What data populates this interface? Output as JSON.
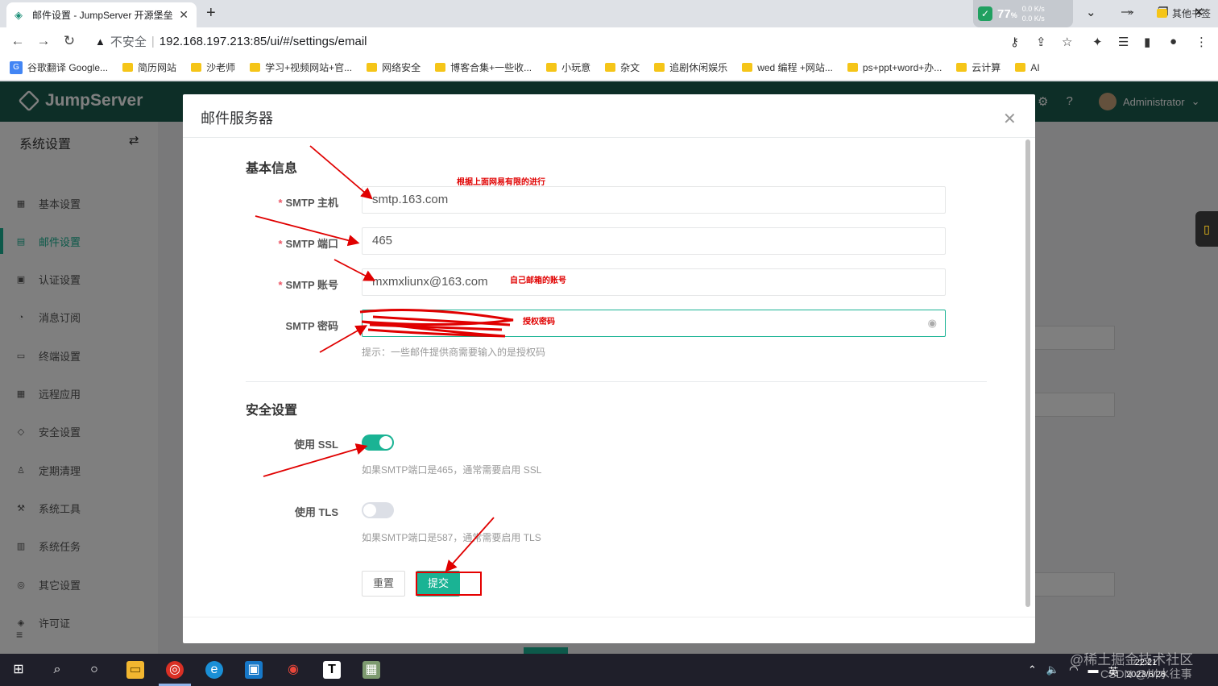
{
  "browser": {
    "tab_title": "邮件设置 - JumpServer 开源堡垒",
    "cpu_percent": "77",
    "speed_up": "0.0",
    "speed_down": "0.0",
    "speed_unit": "K/s",
    "address_insecure": "不安全",
    "address_url": "192.168.197.213:85/ui/#/settings/email",
    "bookmarks": [
      {
        "label": "谷歌翻译 Google...",
        "icon": "translate-icon"
      },
      {
        "label": "简历网站",
        "icon": "folder-icon"
      },
      {
        "label": "沙老师",
        "icon": "folder-icon"
      },
      {
        "label": "学习+视频网站+官...",
        "icon": "folder-icon"
      },
      {
        "label": "网络安全",
        "icon": "folder-icon"
      },
      {
        "label": "博客合集+一些收...",
        "icon": "folder-icon"
      },
      {
        "label": "小玩意",
        "icon": "folder-icon"
      },
      {
        "label": "杂文",
        "icon": "folder-icon"
      },
      {
        "label": "追剧休闲娱乐",
        "icon": "folder-icon"
      },
      {
        "label": "wed 编程 +网站...",
        "icon": "folder-icon"
      },
      {
        "label": "ps+ppt+word+办...",
        "icon": "folder-icon"
      },
      {
        "label": "云计算",
        "icon": "folder-icon"
      },
      {
        "label": "AI",
        "icon": "folder-icon"
      }
    ],
    "bookmarks_more": "»",
    "bookmarks_other": "其他书签"
  },
  "app": {
    "logo": "JumpServer",
    "user": "Administrator",
    "sidebar_title": "系统设置",
    "sidebar_items": [
      {
        "label": "基本设置",
        "active": false
      },
      {
        "label": "邮件设置",
        "active": true
      },
      {
        "label": "认证设置",
        "active": false
      },
      {
        "label": "消息订阅",
        "active": false
      },
      {
        "label": "终端设置",
        "active": false
      },
      {
        "label": "远程应用",
        "active": false
      },
      {
        "label": "安全设置",
        "active": false
      },
      {
        "label": "定期清理",
        "active": false
      },
      {
        "label": "系统工具",
        "active": false
      },
      {
        "label": "系统任务",
        "active": false
      },
      {
        "label": "其它设置",
        "active": false
      },
      {
        "label": "许可证",
        "active": false
      }
    ]
  },
  "dialog": {
    "title": "邮件服务器",
    "basic_section": "基本信息",
    "host_label": "SMTP 主机",
    "host_value": "smtp.163.com",
    "port_label": "SMTP 端口",
    "port_value": "465",
    "account_label": "SMTP 账号",
    "account_value": "mxmxliunx@163.com",
    "password_label": "SMTP 密码",
    "password_hint": "提示：一些邮件提供商需要输入的是授权码",
    "security_section": "安全设置",
    "ssl_label": "使用 SSL",
    "ssl_on": true,
    "ssl_hint": "如果SMTP端口是465，通常需要启用 SSL",
    "tls_label": "使用 TLS",
    "tls_on": false,
    "tls_hint": "如果SMTP端口是587，通常需要启用 TLS",
    "reset_label": "重置",
    "submit_label": "提交"
  },
  "annotations": {
    "note_host": "根据上面网易有限的进行",
    "note_account": "自己邮箱的账号",
    "note_password": "授权密码",
    "color": "#e00000"
  },
  "taskbar": {
    "time": "22:21",
    "date": "2023/6/26",
    "ime": "英"
  },
  "watermark": {
    "line1": "@稀土掘金技术社区",
    "line2": "CSDN @川水往事"
  },
  "colors": {
    "accent": "#1ab394",
    "header": "#1a5c4e",
    "required": "#ed5565"
  }
}
